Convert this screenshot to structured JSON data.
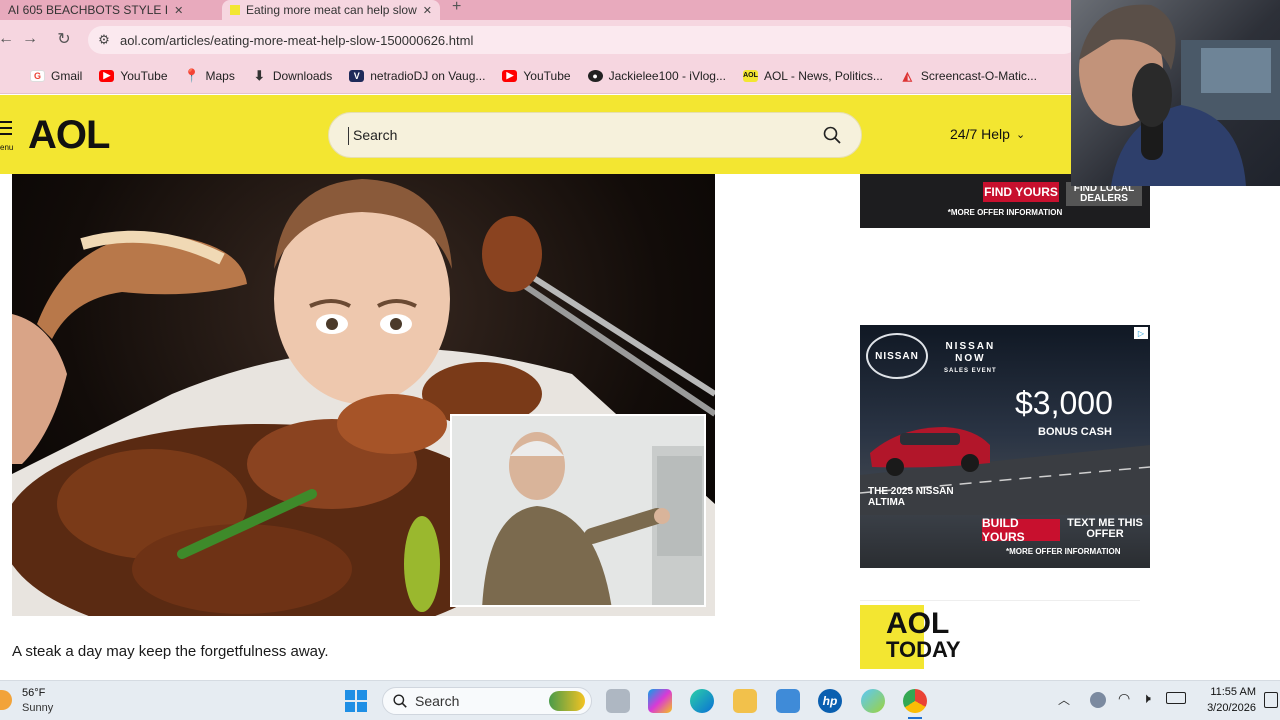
{
  "browser": {
    "tabs": [
      {
        "title": "AI 605 BEACHBOTS STYLE I",
        "active": false
      },
      {
        "title": "Eating more meat can help slow",
        "active": true
      }
    ],
    "new_tab_symbol": "+",
    "url": "aol.com/articles/eating-more-meat-help-slow-150000626.html",
    "bookmarks": [
      {
        "label": "Gmail",
        "icon": "gmail-icon",
        "color": "#ea4335"
      },
      {
        "label": "YouTube",
        "icon": "youtube-icon",
        "color": "#ff0000"
      },
      {
        "label": "Maps",
        "icon": "maps-icon",
        "color": "#34a853"
      },
      {
        "label": "Downloads",
        "icon": "download-icon",
        "color": "#333333"
      },
      {
        "label": "netradioDJ on Vaug...",
        "icon": "vaughn-icon",
        "color": "#1e2a5a"
      },
      {
        "label": "YouTube",
        "icon": "youtube-icon",
        "color": "#ff0000"
      },
      {
        "label": "Jackielee100 - iVlog...",
        "icon": "ivlog-icon",
        "color": "#222222"
      },
      {
        "label": "AOL - News, Politics...",
        "icon": "aol-icon",
        "color": "#f3e631"
      },
      {
        "label": "Screencast-O-Matic...",
        "icon": "screencast-icon",
        "color": "#d33"
      }
    ]
  },
  "aol": {
    "logo": "AOL",
    "menu_label": "enu",
    "search_placeholder": "Search",
    "help_label": "24/7 Help",
    "accent": "#f3e631"
  },
  "article": {
    "caption": "A steak a day may keep the forgetfulness away."
  },
  "ads": {
    "top": {
      "find_button": "FIND YOURS",
      "dealers_button": "FIND LOCAL DEALERS",
      "more_info": "*MORE OFFER INFORMATION"
    },
    "nissan": {
      "brand": "NISSAN",
      "event_line1": "NISSAN",
      "event_line2": "NOW",
      "event_line3": "SALES EVENT",
      "amount": "$3,000",
      "bonus": "BONUS CASH",
      "model_line1": "THE 2025 NISSAN",
      "model_line2": "ALTIMA",
      "build_button": "BUILD YOURS",
      "text_button": "TEXT ME THIS OFFER",
      "more_info": "*MORE OFFER INFORMATION",
      "badge": "▷"
    },
    "aol_today": {
      "line1": "AOL",
      "line2": "TODAY"
    }
  },
  "taskbar": {
    "weather_temp": "56°F",
    "weather_desc": "Sunny",
    "search_label": "Search",
    "time": "11:55 AM",
    "date": "3/20/2026"
  }
}
